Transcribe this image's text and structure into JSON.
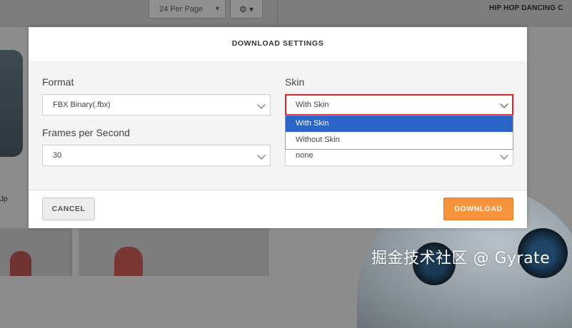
{
  "background": {
    "per_page_select": "24 Per Page",
    "gear_icon": "gear-icon",
    "right_title": "HIP HOP DANCING C",
    "tile_label": "Jp"
  },
  "modal": {
    "title": "DOWNLOAD SETTINGS",
    "format": {
      "label": "Format",
      "value": "FBX Binary(.fbx)"
    },
    "fps": {
      "label": "Frames per Second",
      "value": "30"
    },
    "skin": {
      "label": "Skin",
      "value": "With Skin",
      "options": [
        "With Skin",
        "Without Skin"
      ],
      "highlighted_option": "With Skin"
    },
    "keyframe_reduction": {
      "value": "none"
    },
    "cancel_label": "CANCEL",
    "download_label": "DOWNLOAD"
  },
  "colors": {
    "accent": "#f6913c",
    "focus_border": "#d9242a",
    "option_highlight": "#2b63c6"
  },
  "watermark": "掘金技术社区 @ Gyrate"
}
